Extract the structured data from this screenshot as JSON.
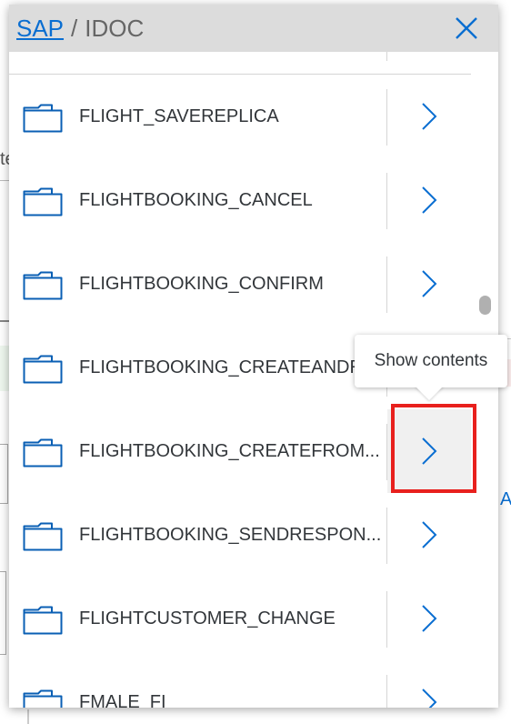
{
  "background": {
    "left_text": "te",
    "right_char": "A"
  },
  "header": {
    "root_link": "SAP",
    "separator": "/",
    "current": "IDOC"
  },
  "rows": [
    {
      "label": ""
    },
    {
      "label": "FLIGHT_SAVEREPLICA"
    },
    {
      "label": "FLIGHTBOOKING_CANCEL"
    },
    {
      "label": "FLIGHTBOOKING_CONFIRM"
    },
    {
      "label": "FLIGHTBOOKING_CREATEANDR..."
    },
    {
      "label": "FLIGHTBOOKING_CREATEFROM..."
    },
    {
      "label": "FLIGHTBOOKING_SENDRESPON..."
    },
    {
      "label": "FLIGHTCUSTOMER_CHANGE"
    },
    {
      "label": "FMALE_FI"
    }
  ],
  "tooltip": {
    "text": "Show contents"
  },
  "colors": {
    "accent": "#0a6ed1",
    "highlight": "#e8201d"
  }
}
